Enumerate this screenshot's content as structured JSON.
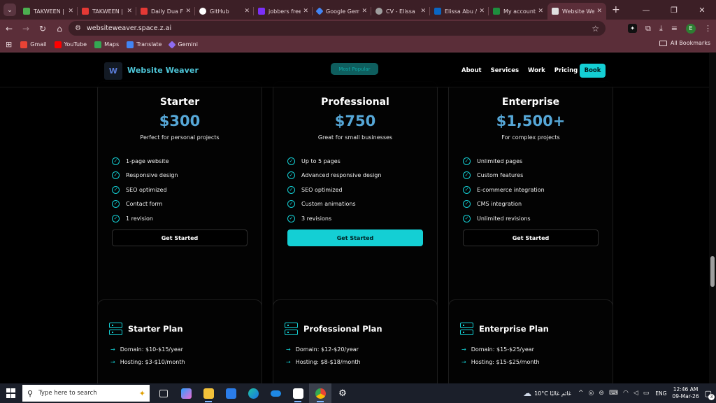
{
  "browser": {
    "tabs": [
      {
        "title": "TAKWEEN |",
        "color": "#4caf50"
      },
      {
        "title": "TAKWEEN |",
        "color": "#e53935"
      },
      {
        "title": "Daily Dua F",
        "color": "#e53935"
      },
      {
        "title": "GitHub",
        "color": "#ffffff"
      },
      {
        "title": "jobbers free",
        "color": "#7b2ff7"
      },
      {
        "title": "Google Gem",
        "color": "#4285f4"
      },
      {
        "title": "CV - Elissa",
        "color": "#9e9e9e"
      },
      {
        "title": "Elissa Abu /",
        "color": "#0a66c2"
      },
      {
        "title": "My account",
        "color": "#1e8e3e"
      },
      {
        "title": "Website We",
        "color": "#e0e0e0"
      }
    ],
    "new_tab": "+",
    "url": "websiteweaver.space.z.ai",
    "profile_initial": "E",
    "bookmarks": [
      {
        "label": "Gmail",
        "color": "#ea4335"
      },
      {
        "label": "YouTube",
        "color": "#ff0000"
      },
      {
        "label": "Maps",
        "color": "#34a853"
      },
      {
        "label": "Translate",
        "color": "#4285f4"
      },
      {
        "label": "Gemini",
        "color": "#8e6cf0"
      }
    ],
    "all_bookmarks": "All Bookmarks"
  },
  "site": {
    "brand": "Website Weaver",
    "popular_badge": "Most Popular",
    "menu": [
      "About",
      "Services",
      "Work",
      "Pricing"
    ],
    "book": "Book",
    "plans": [
      {
        "name": "Starter",
        "price": "$300",
        "subtitle": "Perfect for personal projects",
        "features": [
          "1-page website",
          "Responsive design",
          "SEO optimized",
          "Contact form",
          "1 revision"
        ],
        "cta": "Get Started"
      },
      {
        "name": "Professional",
        "price": "$750",
        "subtitle": "Great for small businesses",
        "features": [
          "Up to 5 pages",
          "Advanced responsive design",
          "SEO optimized",
          "Custom animations",
          "3 revisions"
        ],
        "cta": "Get Started"
      },
      {
        "name": "Enterprise",
        "price": "$1,500+",
        "subtitle": "For complex projects",
        "features": [
          "Unlimited pages",
          "Custom features",
          "E-commerce integration",
          "CMS integration",
          "Unlimited revisions"
        ],
        "cta": "Get Started"
      }
    ],
    "hosting": [
      {
        "title": "Starter Plan",
        "domain": "Domain: $10-$15/year",
        "hosting": "Hosting: $3-$10/month"
      },
      {
        "title": "Professional Plan",
        "domain": "Domain: $12-$20/year",
        "hosting": "Hosting: $8-$18/month"
      },
      {
        "title": "Enterprise Plan",
        "domain": "Domain: $15-$25/year",
        "hosting": "Hosting: $15-$25/month"
      }
    ]
  },
  "taskbar": {
    "search_placeholder": "Type here to search",
    "weather": "10°C",
    "weather_text": "غائم غالبًا",
    "lang": "ENG",
    "time": "12:46 AM",
    "date": "09-Mar-26",
    "notif_count": "3"
  },
  "colors": {
    "accent": "#14cfd4",
    "price": "#56a7d7",
    "chrome": "#5b2e39"
  }
}
